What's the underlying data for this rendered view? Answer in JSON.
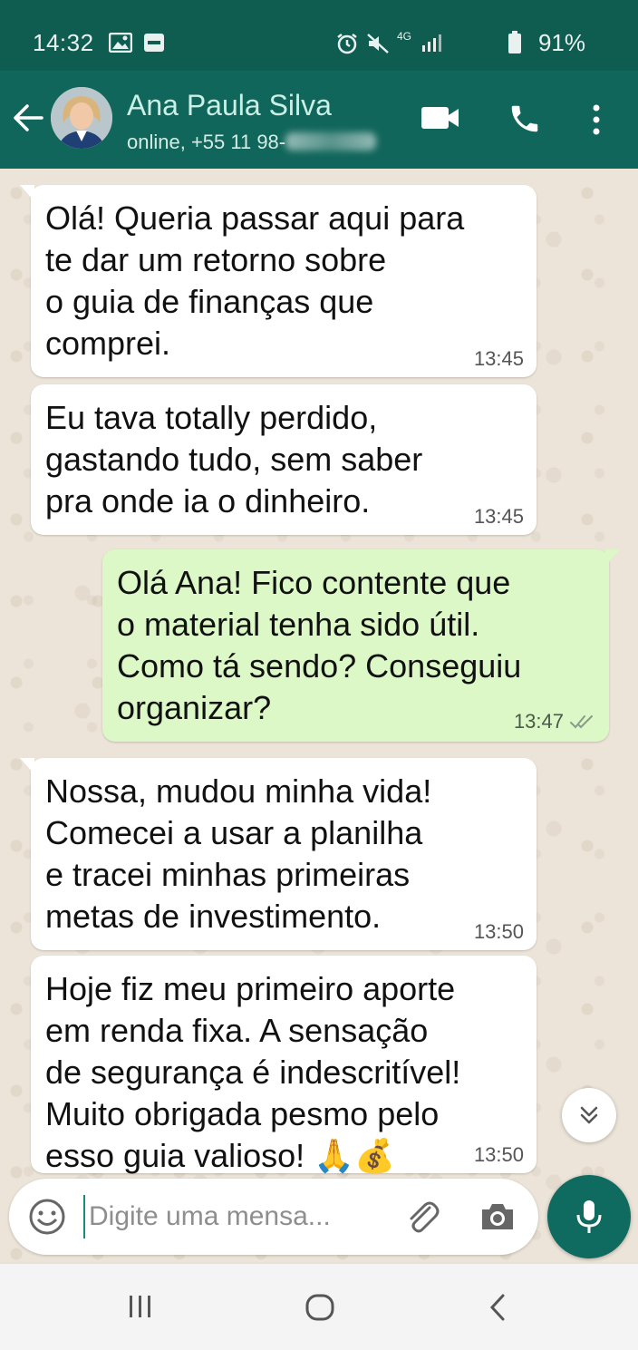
{
  "status_bar": {
    "time": "14:32",
    "network": "4G",
    "battery": "91%",
    "icons": [
      "image-icon",
      "notification-icon",
      "alarm-icon",
      "mute-icon",
      "signal-icon",
      "battery-icon"
    ]
  },
  "header": {
    "contact_name": "Ana Paula Silva",
    "status_prefix": "online, +55 11 98-",
    "icons": [
      "back-arrow-icon",
      "avatar",
      "video-call-icon",
      "phone-icon",
      "more-vert-icon"
    ]
  },
  "messages": [
    {
      "direction": "in",
      "text": "Olá! Queria passar aqui para\nte dar um retorno sobre\no guia de finanças que\ncomprei.",
      "time": "13:45"
    },
    {
      "direction": "in",
      "text": "Eu tava totally perdido,\ngastando tudo, sem saber\npra onde ia o dinheiro.",
      "time": "13:45"
    },
    {
      "direction": "out",
      "text": "Olá Ana! Fico contente que\no material tenha sido útil.\nComo tá sendo? Conseguiu\norganizar?",
      "time": "13:47",
      "status": "read"
    },
    {
      "direction": "in",
      "text": "Nossa, mudou minha vida!\nComecei a usar a planilha\ne tracei minhas primeiras\nmetas de investimento.",
      "time": "13:50"
    },
    {
      "direction": "in",
      "text": "Hoje fiz meu primeiro aporte\nem renda fixa. A sensação\nde segurança é indescritível!\nMuito obrigada pesmo pelo\nesso guia valioso! 🙏💰",
      "time": "13:50"
    }
  ],
  "composer": {
    "placeholder": "Digite uma mensa..."
  },
  "colors": {
    "header": "#11665b",
    "status_bar": "#0f5c51",
    "outgoing_bubble": "#dcf8c6",
    "incoming_bubble": "#ffffff",
    "mic_button": "#0f6b5f"
  }
}
